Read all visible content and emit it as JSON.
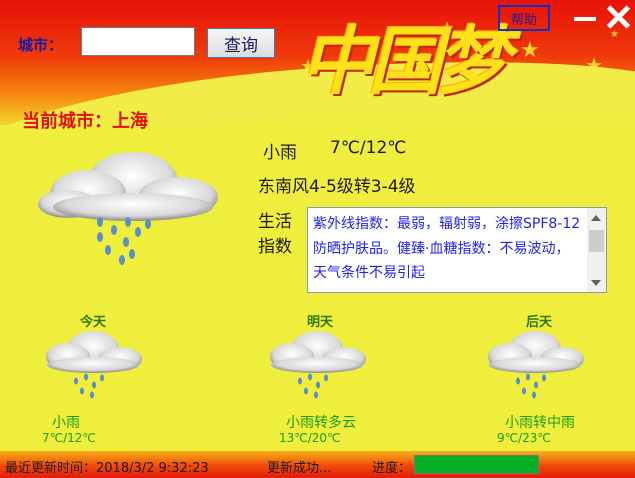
{
  "header": {
    "city_label": "城市：",
    "city_input_value": "",
    "search_label": "查询",
    "banner_title": "中国梦",
    "help_label": "帮助"
  },
  "current": {
    "city": "当前城市：上海",
    "condition": "小雨",
    "temperature": "7℃/12℃",
    "wind": "东南风4-5级转3-4级",
    "life_label": "生活指数",
    "life_text": "紫外线指数：最弱，辐射弱，涂擦SPF8-12防晒护肤品。健臻·血糖指数：不易波动，天气条件不易引起"
  },
  "forecast": [
    {
      "day": "今天",
      "condition": "小雨",
      "temp": "7℃/12℃",
      "icon": "cloud-rain-icon"
    },
    {
      "day": "明天",
      "condition": "小雨转多云",
      "temp": "13℃/20℃",
      "icon": "cloud-rain-icon"
    },
    {
      "day": "后天",
      "condition": "小雨转中雨",
      "temp": "9℃/23℃",
      "icon": "cloud-rain-icon"
    }
  ],
  "status": {
    "last_update": "最近更新时间：2018/3/2 9:32:23",
    "result": "更新成功...",
    "progress_label": "进度：",
    "progress_value": 1.0
  },
  "colors": {
    "banner_red": "#e81208",
    "background_yellow": "#f0ee3c",
    "progress_green": "#06b025",
    "life_text_blue": "#1f1ff0"
  }
}
